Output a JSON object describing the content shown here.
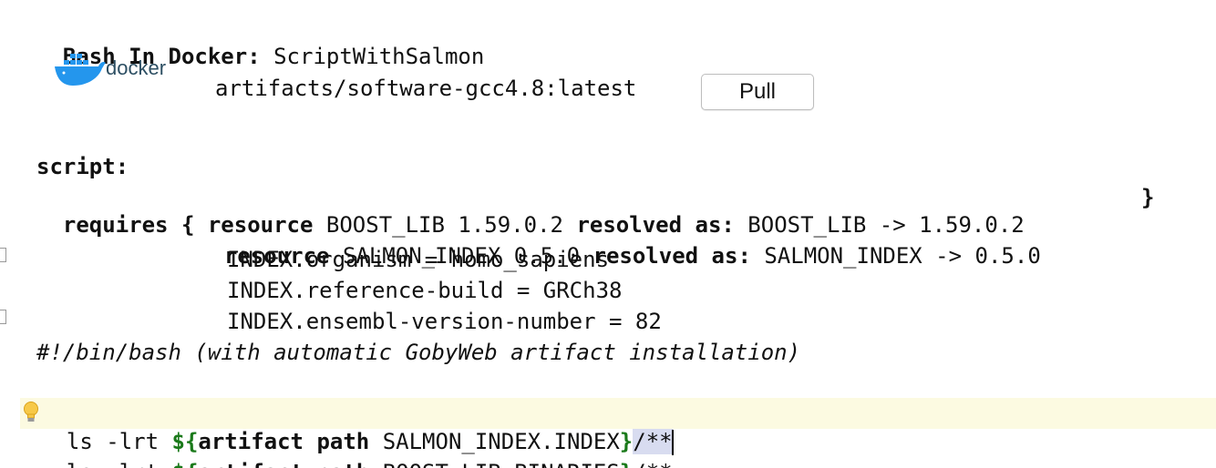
{
  "header": {
    "kind_label": "Bash In Docker",
    "separator": ":",
    "script_name": "ScriptWithSalmon"
  },
  "docker": {
    "logo_text": "docker",
    "image": "artifacts/software-gcc4.8:latest",
    "pull_label": "Pull"
  },
  "script": {
    "label": "script:",
    "requires_kw": "requires {",
    "close_brace": "}",
    "resources": [
      {
        "resource_kw": "resource",
        "name_version": "BOOST_LIB 1.59.0.2",
        "resolved_kw": "resolved as:",
        "resolved": "BOOST_LIB -> 1.59.0.2"
      },
      {
        "resource_kw": "resource",
        "name_version": "SALMON_INDEX 0.5.0",
        "resolved_kw": "resolved as:",
        "resolved": "SALMON_INDEX -> 0.5.0"
      }
    ],
    "attributes": [
      "INDEX.organism = homo_sapiens",
      "INDEX.reference-build = GRCh38",
      "INDEX.ensembl-version-number = 82"
    ],
    "shebang": "#!/bin/bash (with automatic GobyWeb artifact installation)",
    "commands": [
      {
        "prefix": "ls -lrt ",
        "open": "${",
        "kw": "artifact path",
        "arg": " SALMON_INDEX.INDEX",
        "close": "}",
        "suffix": "/**"
      },
      {
        "prefix": "ls -lrt ",
        "open": "${",
        "kw": "artifact path",
        "arg": " BOOST_LIB.BINARIES",
        "close": "}",
        "suffix": "/**"
      }
    ]
  },
  "colors": {
    "keyword_green": "#1b7a1b",
    "current_line": "#fcfae1",
    "selection": "#d8dcf0",
    "docker_blue": "#2496ed"
  }
}
